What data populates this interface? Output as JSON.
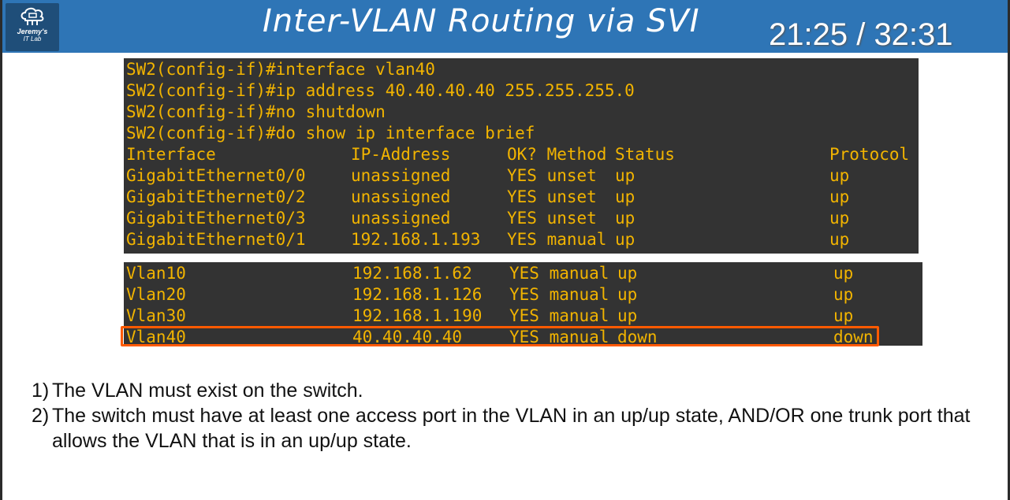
{
  "header": {
    "logo_line1": "Jeremy's",
    "logo_line2": "IT Lab",
    "title": "Inter-VLAN Routing via SVI",
    "timer": "21:25 / 32:31"
  },
  "terminal_top": {
    "commands": [
      "SW2(config-if)#interface vlan40",
      "SW2(config-if)#ip address 40.40.40.40 255.255.255.0",
      "SW2(config-if)#no shutdown",
      "SW2(config-if)#do show ip interface brief"
    ],
    "columns": [
      "Interface",
      "IP-Address",
      "OK? Method",
      "Status",
      "Protocol"
    ],
    "rows": [
      {
        "interface": "GigabitEthernet0/0",
        "ip": "unassigned",
        "ok_method": "YES unset",
        "status": "up",
        "protocol": "up"
      },
      {
        "interface": "GigabitEthernet0/2",
        "ip": "unassigned",
        "ok_method": "YES unset",
        "status": "up",
        "protocol": "up"
      },
      {
        "interface": "GigabitEthernet0/3",
        "ip": "unassigned",
        "ok_method": "YES unset",
        "status": "up",
        "protocol": "up"
      },
      {
        "interface": "GigabitEthernet0/1",
        "ip": "192.168.1.193",
        "ok_method": "YES manual",
        "status": "up",
        "protocol": "up"
      }
    ]
  },
  "terminal_bottom": {
    "rows": [
      {
        "interface": "Vlan10",
        "ip": "192.168.1.62",
        "ok_method": "YES manual",
        "status": "up",
        "protocol": "up"
      },
      {
        "interface": "Vlan20",
        "ip": "192.168.1.126",
        "ok_method": "YES manual",
        "status": "up",
        "protocol": "up"
      },
      {
        "interface": "Vlan30",
        "ip": "192.168.1.190",
        "ok_method": "YES manual",
        "status": "up",
        "protocol": "up"
      },
      {
        "interface": "Vlan40",
        "ip": "40.40.40.40",
        "ok_method": "YES manual",
        "status": "down",
        "protocol": "down"
      }
    ]
  },
  "notes": [
    {
      "num": "1)",
      "text": "The VLAN must exist on the switch."
    },
    {
      "num": "2)",
      "text": "The switch must have at least one access port in the VLAN in an up/up state, AND/OR one trunk port that allows the VLAN that is in an up/up state."
    }
  ],
  "colors": {
    "header_bg": "#2e75b6",
    "terminal_bg": "#333333",
    "terminal_text": "#f2b400",
    "highlight": "#ff5a00"
  }
}
